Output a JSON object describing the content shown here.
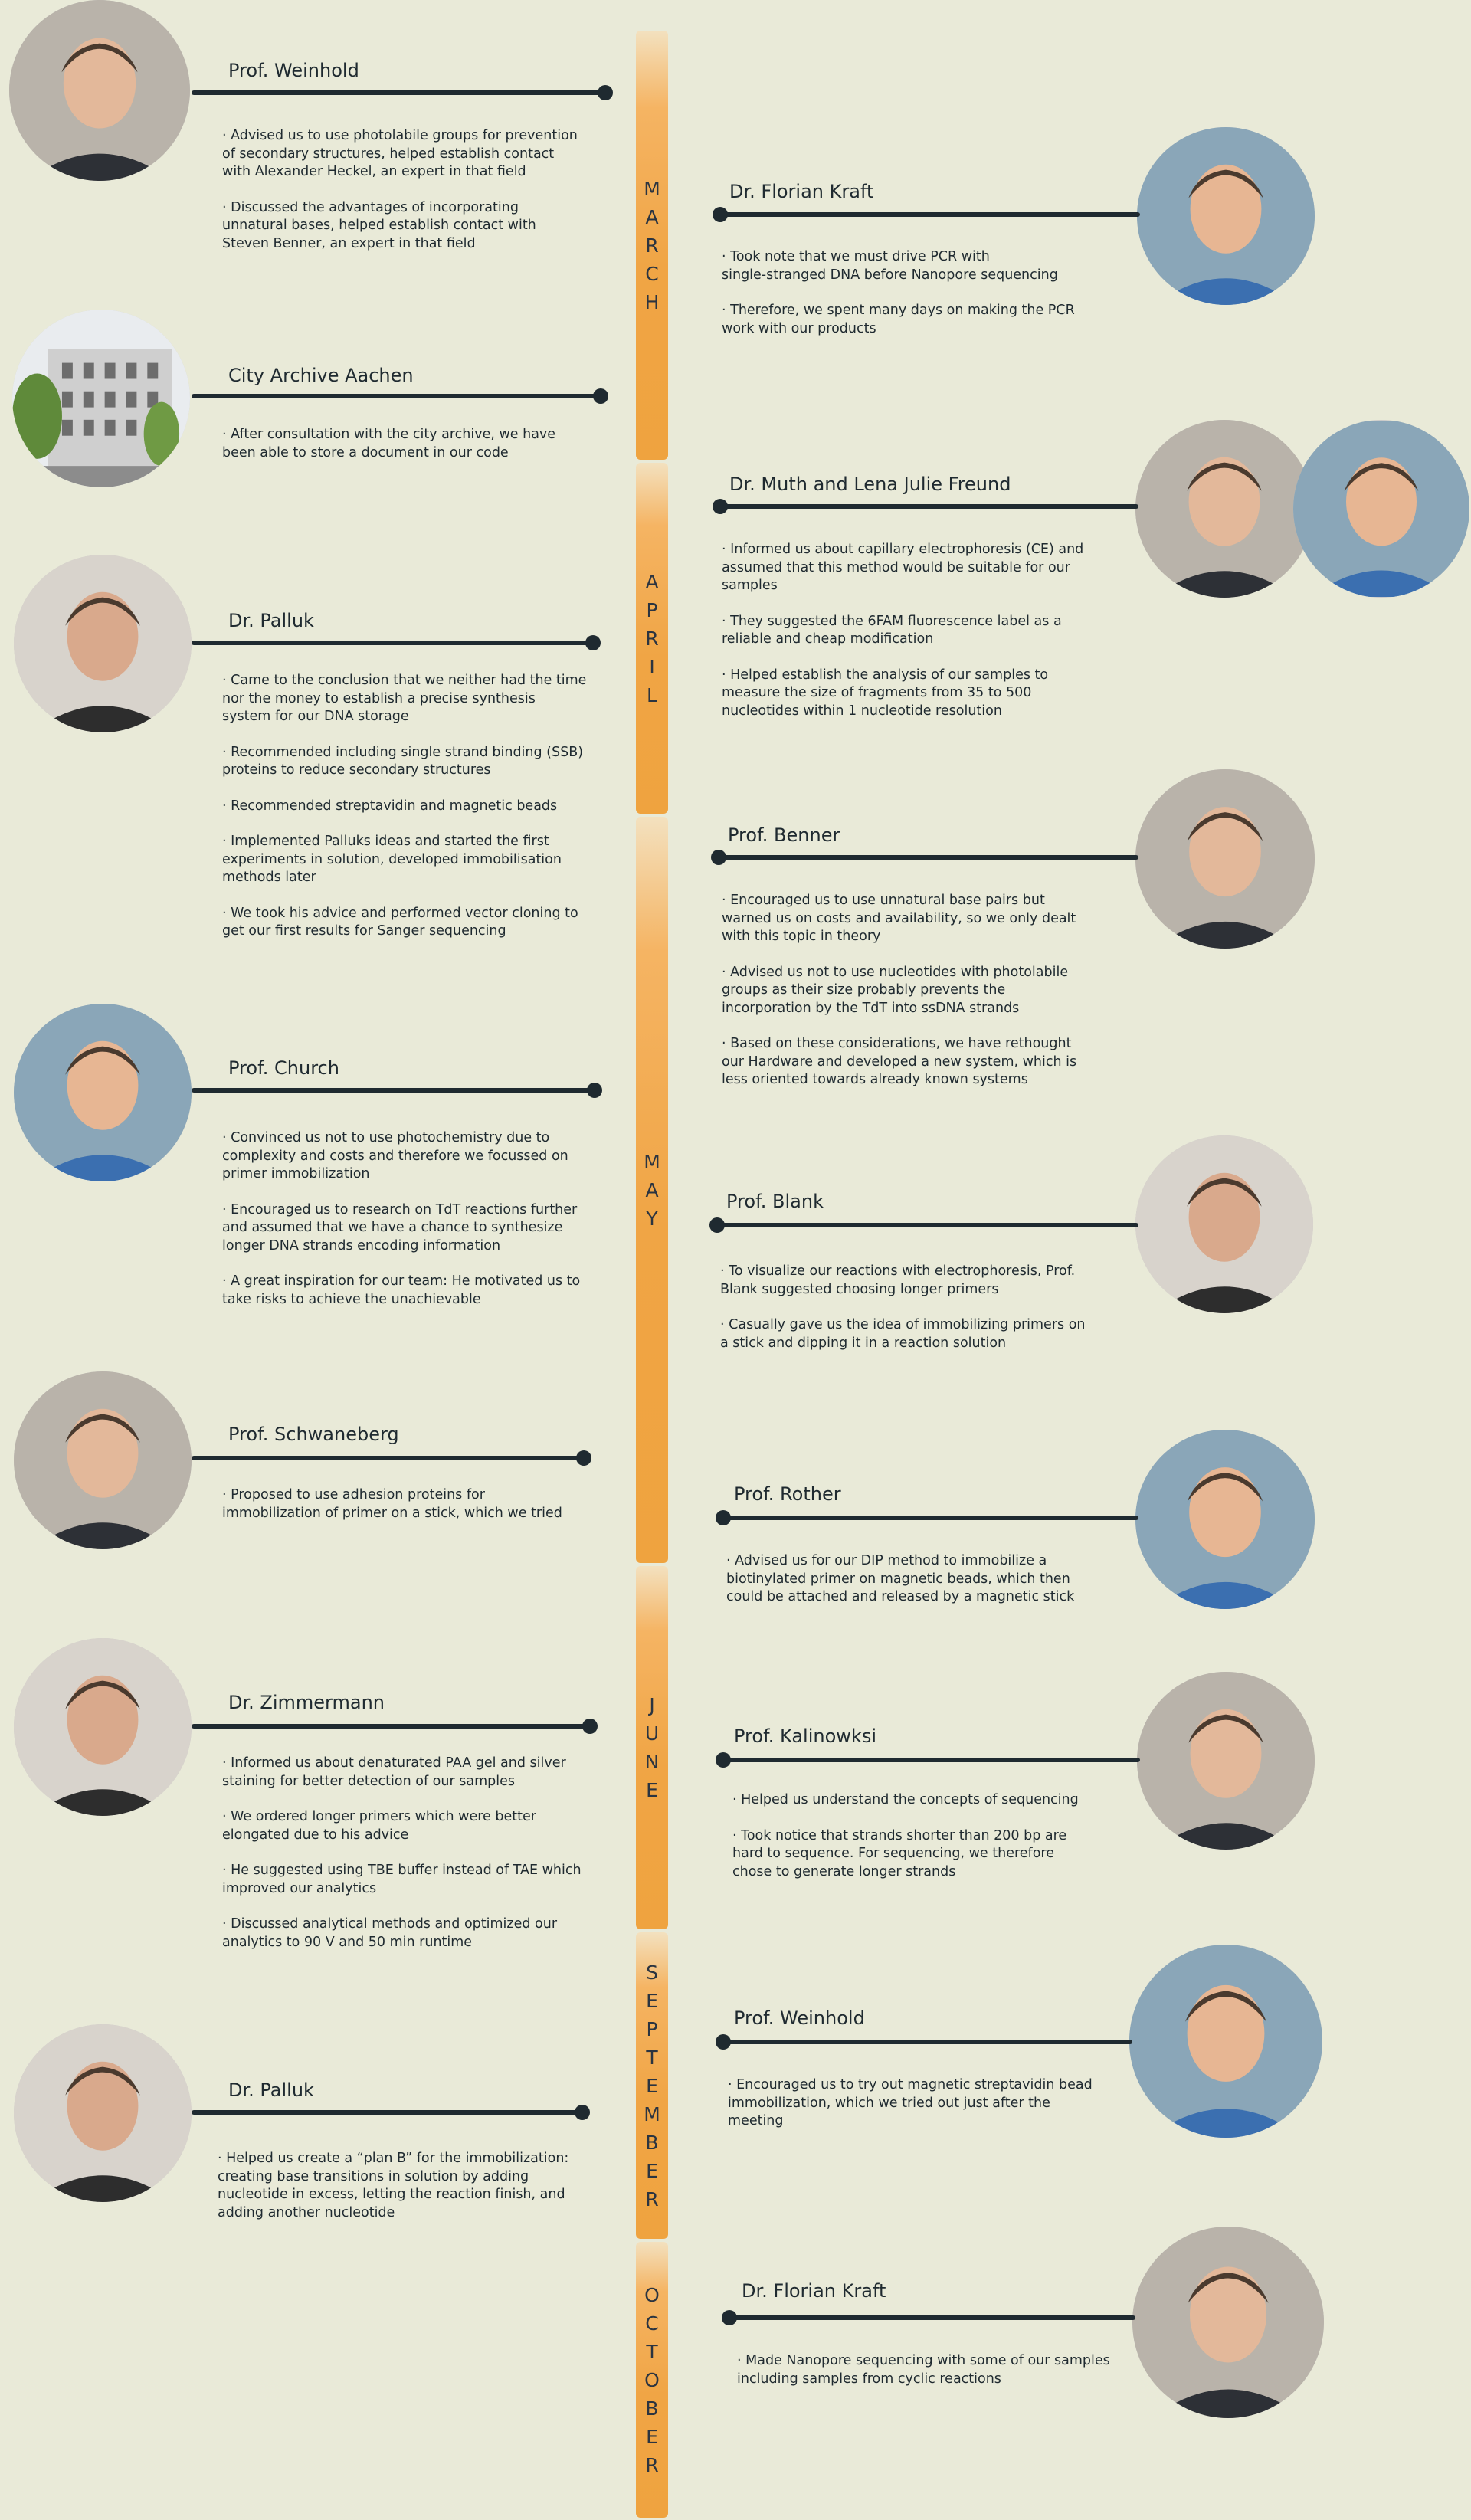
{
  "months": [
    "MARCH",
    "APRIL",
    "MAY",
    "JUNE",
    "SEPTEMBER",
    "OCTOBER"
  ],
  "entries": [
    {
      "name": "Prof. Weinhold",
      "photo": "portrait-man-glasses",
      "bullets": [
        "· Advised us to use photolabile groups for prevention\n of secondary structures, helped establish contact\n with Alexander Heckel, an expert in that field",
        "· Discussed the advantages of incorporating\n unnatural bases, helped establish contact with\n Steven Benner, an expert in that field"
      ]
    },
    {
      "name": "Dr. Florian Kraft",
      "photo": "portrait-man-outdoor",
      "bullets": [
        "· Took note that we must drive PCR with\n single-stranged DNA before Nanopore sequencing",
        "· Therefore, we spent many days on making the PCR\n work with our products"
      ]
    },
    {
      "name": "City Archive Aachen",
      "photo": "building-photo",
      "bullets": [
        "· After consultation with the city archive, we have\n been able to store a document in our code"
      ]
    },
    {
      "name": "Dr. Muth and Lena Julie Freund",
      "photo": "two-portraits",
      "bullets": [
        "· Informed us about capillary electrophoresis (CE) and\n assumed that this method would be suitable for our\n samples",
        "· They suggested the 6FAM fluorescence label as a\n reliable and cheap modification",
        "· Helped establish the analysis of our samples to\n measure the size of fragments from 35 to 500\n nucleotides within 1 nucleotide resolution"
      ]
    },
    {
      "name": "Dr. Palluk",
      "photo": "portrait-man-beard",
      "bullets": [
        "· Came to the conclusion that we neither had the time\n nor the money to establish a precise synthesis\n system for our DNA storage",
        "· Recommended including single strand binding (SSB)\n proteins to reduce secondary structures",
        "· Recommended streptavidin and magnetic beads",
        "· Implemented Palluks ideas and started the first\n experiments in solution, developed immobilisation\n methods later",
        "· We took his advice and performed vector cloning to\n get our first results for Sanger sequencing"
      ]
    },
    {
      "name": "Prof. Benner",
      "photo": "portrait-man-gray-hair",
      "bullets": [
        "· Encouraged us to use unnatural base pairs but\n warned us on costs and availability, so we only dealt\n with this topic in theory",
        "· Advised us not to use nucleotides with photolabile\n groups as their size probably prevents the\n incorporation by the TdT into ssDNA strands",
        "· Based on these considerations, we have rethought\n our Hardware and developed a new system, which is\n less oriented towards already known systems"
      ]
    },
    {
      "name": "Prof. Church",
      "photo": "portrait-man-white-beard",
      "bullets": [
        "· Convinced us not to use photochemistry due to\n complexity and costs and therefore we focussed on\n primer immobilization",
        "· Encouraged us to research on TdT reactions further\n and assumed that we have a chance to synthesize\n longer DNA strands encoding information",
        "· A great inspiration for our team: He motivated us to\n take risks to achieve the unachievable"
      ]
    },
    {
      "name": "Prof. Blank",
      "photo": "portrait-man-lab",
      "bullets": [
        "· To visualize our reactions with electrophoresis, Prof.\n Blank suggested choosing longer primers",
        "· Casually gave us the idea of immobilizing primers on\n a stick and dipping it in a reaction solution"
      ]
    },
    {
      "name": "Prof. Schwaneberg",
      "photo": "portrait-man-suit",
      "bullets": [
        "· Proposed to use adhesion proteins for\n immobilization of primer on a stick, which we tried"
      ]
    },
    {
      "name": "Prof. Rother",
      "photo": "portrait-woman-blonde",
      "bullets": [
        "· Advised us for our DIP method to immobilize a\n biotinylated primer on magnetic beads, which then\n could be attached and released by a magnetic stick"
      ]
    },
    {
      "name": "Dr. Zimmermann",
      "photo": "portrait-man-office",
      "bullets": [
        "· Informed us about denaturated PAA gel and silver\n staining for better detection of our samples",
        "· We ordered longer primers which were better\n elongated due to his advice",
        "· He suggested using TBE buffer instead of TAE which\n improved our analytics",
        "· Discussed analytical methods and optimized our\n analytics to 90 V and 50 min runtime"
      ]
    },
    {
      "name": "Prof. Kalinowksi",
      "photo": "portrait-man-blond",
      "bullets": [
        "· Helped us understand the concepts of sequencing",
        "· Took notice that strands shorter than 200 bp are\n hard to sequence. For sequencing, we therefore\n chose to generate longer strands"
      ]
    },
    {
      "name": "Prof. Weinhold",
      "photo": "portrait-man-glasses",
      "bullets": [
        "· Encouraged us to try out magnetic streptavidin bead\n immobilization, which we tried out  just after the\n meeting"
      ]
    },
    {
      "name": "Dr. Palluk",
      "photo": "portrait-man-beard",
      "bullets": [
        "· Helped us create a “plan B” for the immobilization:\n creating base transitions in solution by adding\n nucleotide in excess, letting the reaction finish, and\n adding another nucleotide"
      ]
    },
    {
      "name": "Dr. Florian Kraft",
      "photo": "portrait-man-outdoor",
      "bullets": [
        "· Made Nanopore sequencing with some of our samples\n including samples from cyclic reactions"
      ]
    }
  ],
  "colors": {
    "background": "#e9ead8",
    "spine": "#f0a545",
    "line": "#1f2a30"
  }
}
